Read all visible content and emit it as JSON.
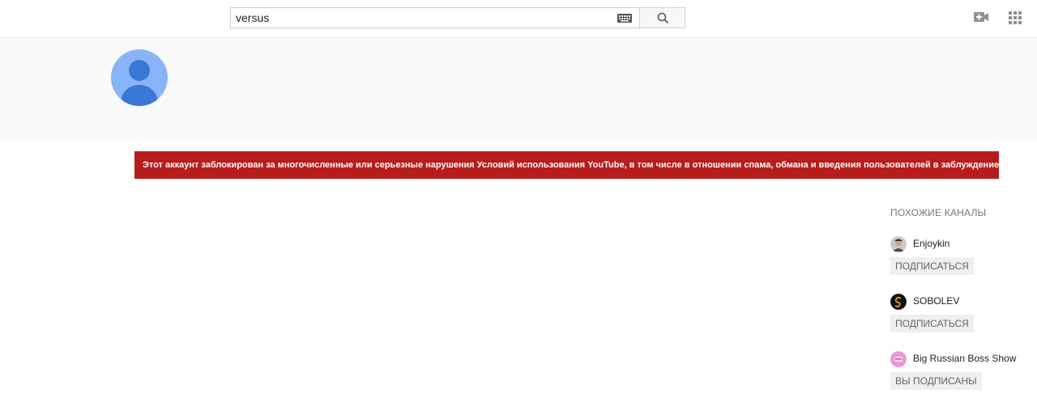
{
  "search": {
    "value": "versus"
  },
  "icons": {
    "keyboard": "keyboard-icon",
    "search": "search-icon",
    "upload": "video-upload-icon",
    "apps": "apps-grid-icon"
  },
  "alert": {
    "text": "Этот аккаунт заблокирован за многочисленные или серьезные нарушения Условий использования YouTube, в том числе в отношении спама, обмана и введения пользователей в заблуждение.",
    "color": "#b71c1c"
  },
  "related": {
    "title": "ПОХОЖИЕ КАНАЛЫ",
    "channels": [
      {
        "name": "Enjoykin",
        "button": "ПОДПИСАТЬСЯ"
      },
      {
        "name": "SOBOLEV",
        "button": "ПОДПИСАТЬСЯ"
      },
      {
        "name": "Big Russian Boss Show",
        "button": "ВЫ ПОДПИСАНЫ"
      }
    ]
  }
}
